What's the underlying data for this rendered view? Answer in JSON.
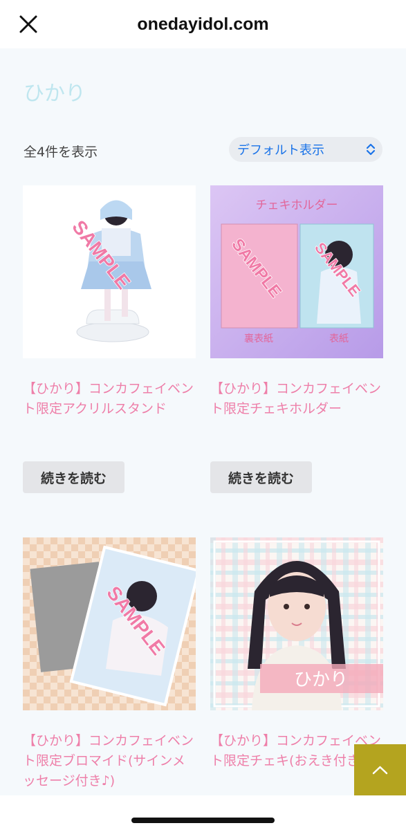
{
  "header": {
    "site": "onedayidol.com"
  },
  "page": {
    "heading": "ひかり",
    "result_count": "全4件を表示",
    "sort_selected": "デフォルト表示"
  },
  "products": [
    {
      "title": "【ひかり】コンカフェイベント限定アクリルスタンド",
      "read_more": "続きを読む",
      "image": {
        "watermark": "SAMPLE"
      }
    },
    {
      "title": "【ひかり】コンカフェイベント限定チェキホルダー",
      "read_more": "続きを読む",
      "image": {
        "watermark": "SAMPLE",
        "header": "チェキホルダー",
        "label_left": "裏表紙",
        "label_right": "表紙"
      }
    },
    {
      "title": "【ひかり】コンカフェイベント限定ブロマイド(サインメッセージ付き♪)",
      "image": {
        "watermark": "SAMPLE"
      }
    },
    {
      "title": "【ひかり】コンカフェイベント限定チェキ(おえき付き♪)",
      "image": {
        "name_label": "ひかり"
      }
    }
  ],
  "colors": {
    "title_pink": "#ee7fa9",
    "heading_cyan": "#bfe6ef",
    "select_blue": "#1a73e8",
    "scroll_top_olive": "#b4a41f"
  },
  "icons": {
    "close": "close-icon",
    "sort": "sort-arrows-icon",
    "scroll_top": "chevron-up-icon"
  }
}
